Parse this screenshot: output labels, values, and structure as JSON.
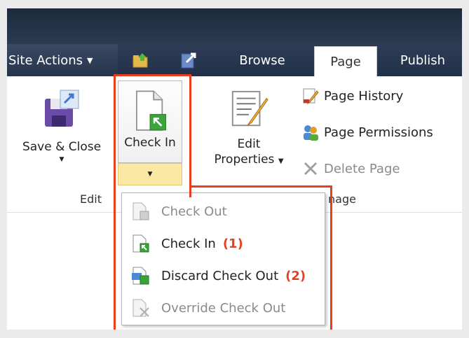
{
  "tabs": {
    "site_actions": "Site Actions",
    "browse": "Browse",
    "page": "Page",
    "publish": "Publish"
  },
  "ribbon": {
    "save_close": "Save & Close",
    "check_in": "Check In",
    "edit_properties_1": "Edit",
    "edit_properties_2": "Properties",
    "page_history": "Page History",
    "page_permissions": "Page Permissions",
    "delete_page": "Delete Page",
    "group_edit": "Edit",
    "group_manage": "nage"
  },
  "menu": {
    "items": [
      {
        "label": "Check Out",
        "enabled": false,
        "callout": ""
      },
      {
        "label": "Check In",
        "enabled": true,
        "callout": "(1)"
      },
      {
        "label": "Discard Check Out",
        "enabled": true,
        "callout": "(2)"
      },
      {
        "label": "Override Check Out",
        "enabled": false,
        "callout": ""
      }
    ]
  },
  "colors": {
    "highlight": "#e8401f",
    "dropdown_active": "#fbe8a4",
    "tab_bar": "#2e3d55"
  },
  "icons": {
    "save_close": "save-close-icon",
    "check_in": "check-in-icon",
    "edit_properties": "edit-properties-icon",
    "page_history": "page-history-icon",
    "page_permissions": "page-permissions-icon",
    "delete_page": "delete-icon"
  }
}
